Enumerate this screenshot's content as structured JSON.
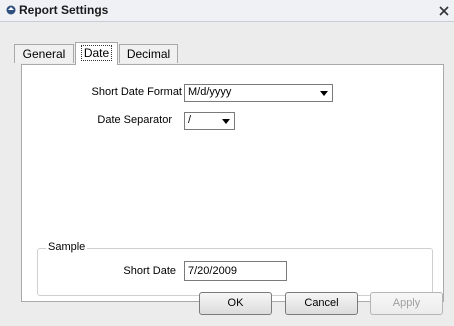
{
  "window": {
    "title": "Report Settings"
  },
  "tabs": [
    {
      "label": "General"
    },
    {
      "label": "Date"
    },
    {
      "label": "Decimal"
    }
  ],
  "date_tab": {
    "short_date_format_label": "Short Date Format",
    "short_date_format_value": "M/d/yyyy",
    "date_separator_label": "Date Separator",
    "date_separator_value": "/",
    "sample_group_title": "Sample",
    "short_date_label": "Short Date",
    "short_date_value": "7/20/2009"
  },
  "buttons": {
    "ok": "OK",
    "cancel": "Cancel",
    "apply": "Apply"
  },
  "icons": {
    "app": "report-app-icon",
    "close": "close-icon",
    "dropdown": "chevron-down-icon"
  },
  "colors": {
    "title_bar": "#eff1f5",
    "dialog_bg": "#ececec",
    "panel_bg": "#ffffff",
    "disabled_text": "#a0a0a0"
  }
}
